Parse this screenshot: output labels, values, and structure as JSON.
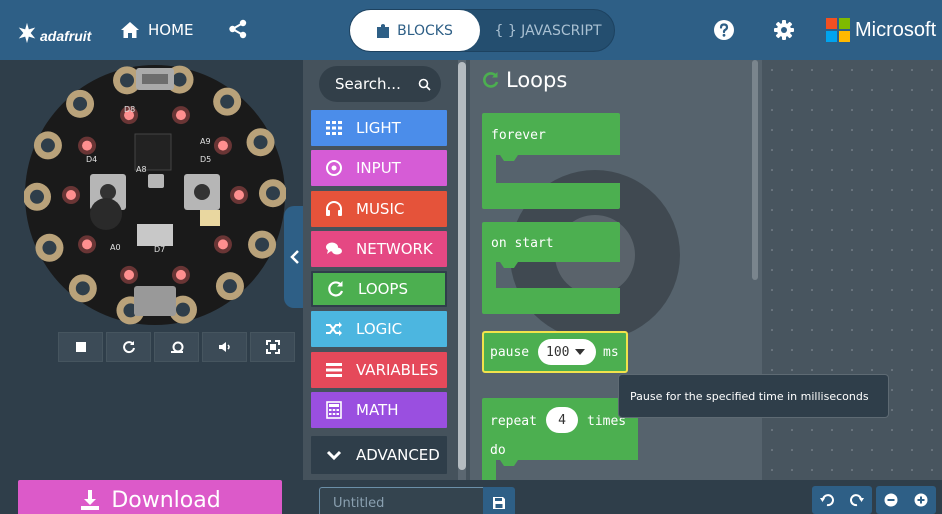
{
  "header": {
    "brand": "adafruit",
    "home_label": "HOME",
    "blocks_label": "BLOCKS",
    "javascript_label": "{ } JAVASCRIPT",
    "microsoft_label": "Microsoft",
    "colors": {
      "bar": "#2e5f86",
      "ms_red": "#f25022",
      "ms_green": "#7fba00",
      "ms_blue": "#00a4ef",
      "ms_yellow": "#ffb900"
    }
  },
  "simulator": {
    "controls": [
      "stop-icon",
      "restart-icon",
      "slowmo-icon",
      "mute-icon",
      "fullscreen-icon"
    ]
  },
  "toolbox": {
    "search_placeholder": "Search...",
    "categories": [
      {
        "label": "LIGHT",
        "color": "#4b8dea",
        "icon": "grid-icon"
      },
      {
        "label": "INPUT",
        "color": "#d65cd6",
        "icon": "target-icon"
      },
      {
        "label": "MUSIC",
        "color": "#e5533a",
        "icon": "headphones-icon"
      },
      {
        "label": "NETWORK",
        "color": "#e54883",
        "icon": "chat-icon"
      },
      {
        "label": "LOOPS",
        "color": "#4caf50",
        "icon": "loop-icon"
      },
      {
        "label": "LOGIC",
        "color": "#4cb6e0",
        "icon": "shuffle-icon"
      },
      {
        "label": "VARIABLES",
        "color": "#e5495a",
        "icon": "list-icon"
      },
      {
        "label": "MATH",
        "color": "#9a4fe0",
        "icon": "calculator-icon"
      }
    ],
    "advanced_label": "ADVANCED"
  },
  "flyout": {
    "title": "Loops",
    "blocks": {
      "forever": "forever",
      "on_start": "on start",
      "pause": "pause",
      "pause_value": "100",
      "pause_unit": "ms",
      "repeat": "repeat",
      "repeat_value": "4",
      "repeat_times": "times",
      "repeat_do": "do"
    },
    "tooltip": "Pause for the specified time in milliseconds"
  },
  "footer": {
    "download_label": "Download",
    "project_placeholder": "Untitled"
  }
}
